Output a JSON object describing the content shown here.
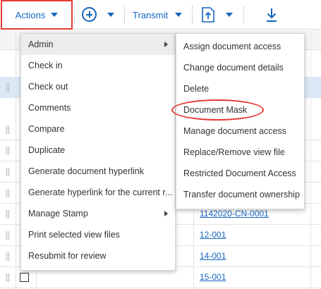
{
  "toolbar": {
    "actions_label": "Actions",
    "transmit_label": "Transmit"
  },
  "actions_menu": {
    "items": [
      {
        "label": "Admin",
        "has_submenu": true
      },
      {
        "label": "Check in"
      },
      {
        "label": "Check out"
      },
      {
        "label": "Comments"
      },
      {
        "label": "Compare"
      },
      {
        "label": "Duplicate"
      },
      {
        "label": "Generate document hyperlink"
      },
      {
        "label": "Generate hyperlink for the current r..."
      },
      {
        "label": "Manage Stamp",
        "has_submenu": true
      },
      {
        "label": "Print selected view files"
      },
      {
        "label": "Resubmit for review"
      }
    ]
  },
  "admin_submenu": {
    "items": [
      {
        "label": "Assign document access"
      },
      {
        "label": "Change document details"
      },
      {
        "label": "Delete"
      },
      {
        "label": "Document Mask",
        "highlighted": true
      },
      {
        "label": "Manage document access"
      },
      {
        "label": "Replace/Remove view file"
      },
      {
        "label": "Restricted Document Access"
      },
      {
        "label": "Transfer document ownership"
      }
    ]
  },
  "table": {
    "visible_document_numbers": [
      "1142020-CN-0001",
      "12-001",
      "14-001",
      "15-001"
    ]
  },
  "colors": {
    "accent": "#1565c0",
    "annotation": "#e53935",
    "selected_row": "#dbe9f7"
  }
}
